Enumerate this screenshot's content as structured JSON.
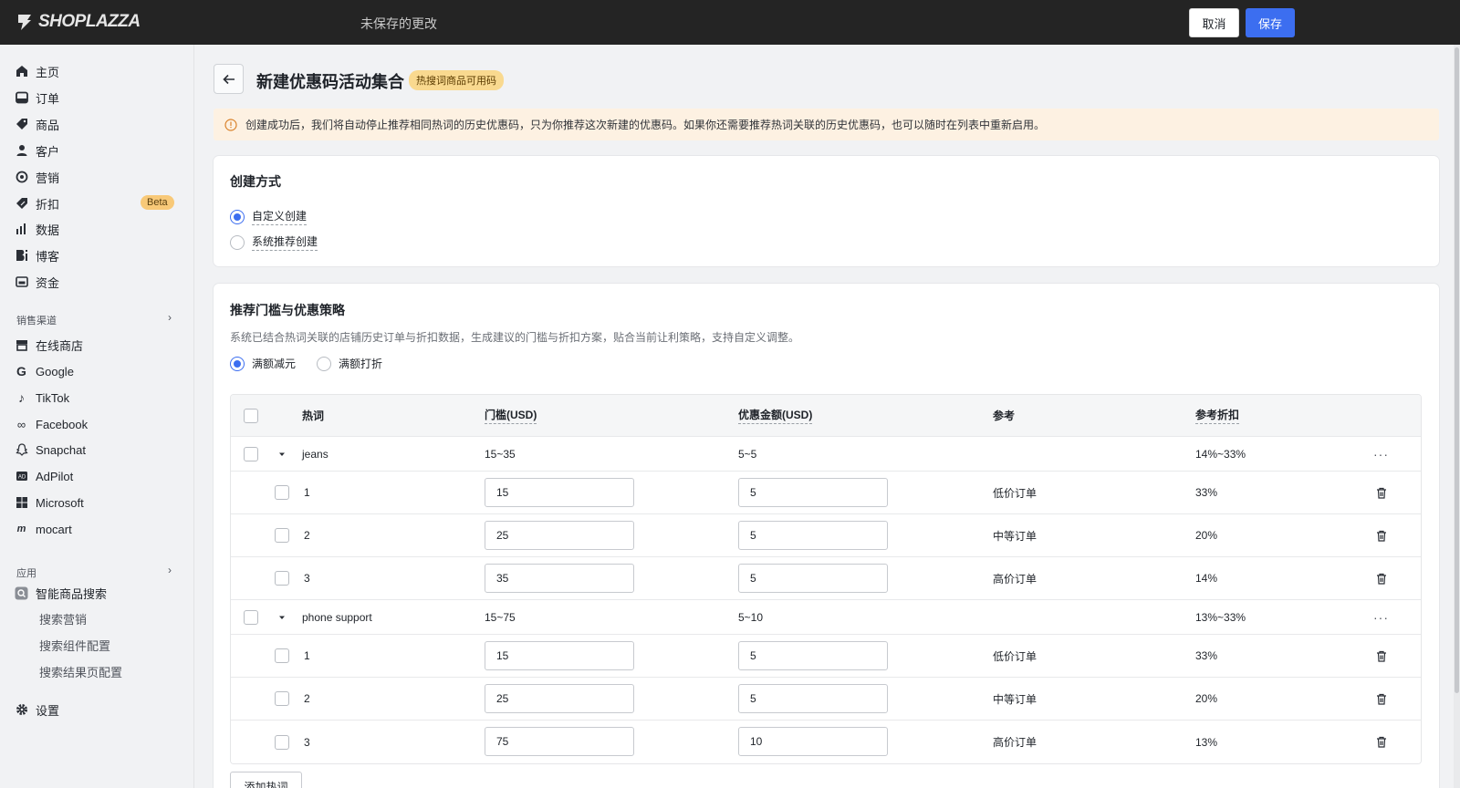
{
  "topbar": {
    "logo_text": "SHOPLAZZA",
    "status_text": "未保存的更改",
    "cancel_label": "取消",
    "save_label": "保存",
    "save_color": "#3c6ef0"
  },
  "sidebar": {
    "main_items": [
      {
        "label": "主页",
        "icon": "home-icon"
      },
      {
        "label": "订单",
        "icon": "order-icon"
      },
      {
        "label": "商品",
        "icon": "tag-icon"
      },
      {
        "label": "客户",
        "icon": "person-icon"
      },
      {
        "label": "营销",
        "icon": "marketing-icon"
      },
      {
        "label": "折扣",
        "icon": "discount-icon",
        "badge": "Beta"
      },
      {
        "label": "数据",
        "icon": "chart-icon"
      },
      {
        "label": "博客",
        "icon": "blog-icon"
      },
      {
        "label": "资金",
        "icon": "wallet-icon"
      }
    ],
    "channels_label": "销售渠道",
    "channels": [
      {
        "label": "在线商店",
        "icon": "store-icon"
      },
      {
        "label": "Google",
        "icon": "google-icon"
      },
      {
        "label": "TikTok",
        "icon": "tiktok-icon"
      },
      {
        "label": "Facebook",
        "icon": "meta-icon"
      },
      {
        "label": "Snapchat",
        "icon": "snapchat-icon"
      },
      {
        "label": "AdPilot",
        "icon": "adpilot-icon"
      },
      {
        "label": "Microsoft",
        "icon": "microsoft-icon"
      },
      {
        "label": "mocart",
        "icon": "mocart-icon"
      }
    ],
    "apps_label": "应用",
    "app_name": "智能商品搜索",
    "app_subitems": [
      "搜索营销",
      "搜索组件配置",
      "搜索结果页配置"
    ],
    "settings_label": "设置"
  },
  "page": {
    "title": "新建优惠码活动集合",
    "badge": "热搜词商品可用码",
    "alert": "创建成功后，我们将自动停止推荐相同热词的历史优惠码，只为你推荐这次新建的优惠码。如果你还需要推荐热词关联的历史优惠码，也可以随时在列表中重新启用。"
  },
  "create_mode": {
    "title": "创建方式",
    "options": [
      "自定义创建",
      "系统推荐创建"
    ],
    "selected": "自定义创建"
  },
  "strategy": {
    "title": "推荐门槛与优惠策略",
    "description": "系统已结合热词关联的店铺历史订单与折扣数据，生成建议的门槛与折扣方案，贴合当前让利策略，支持自定义调整。",
    "options": [
      "满额减元",
      "满额打折"
    ],
    "selected": "满额减元",
    "table": {
      "headers": [
        "热词",
        "门槛(USD)",
        "优惠金额(USD)",
        "参考",
        "参考折扣"
      ],
      "groups": [
        {
          "keyword": "jeans",
          "threshold": "15~35",
          "amount": "5~5",
          "discount": "14%~33%",
          "rows": [
            {
              "index": "1",
              "threshold": "15",
              "amount": "5",
              "ref": "低价订单",
              "discount": "33%"
            },
            {
              "index": "2",
              "threshold": "25",
              "amount": "5",
              "ref": "中等订单",
              "discount": "20%"
            },
            {
              "index": "3",
              "threshold": "35",
              "amount": "5",
              "ref": "高价订单",
              "discount": "14%"
            }
          ]
        },
        {
          "keyword": "phone support",
          "threshold": "15~75",
          "amount": "5~10",
          "discount": "13%~33%",
          "rows": [
            {
              "index": "1",
              "threshold": "15",
              "amount": "5",
              "ref": "低价订单",
              "discount": "33%"
            },
            {
              "index": "2",
              "threshold": "25",
              "amount": "5",
              "ref": "中等订单",
              "discount": "20%"
            },
            {
              "index": "3",
              "threshold": "75",
              "amount": "10",
              "ref": "高价订单",
              "discount": "13%"
            }
          ]
        }
      ]
    },
    "add_button": "添加热词"
  }
}
